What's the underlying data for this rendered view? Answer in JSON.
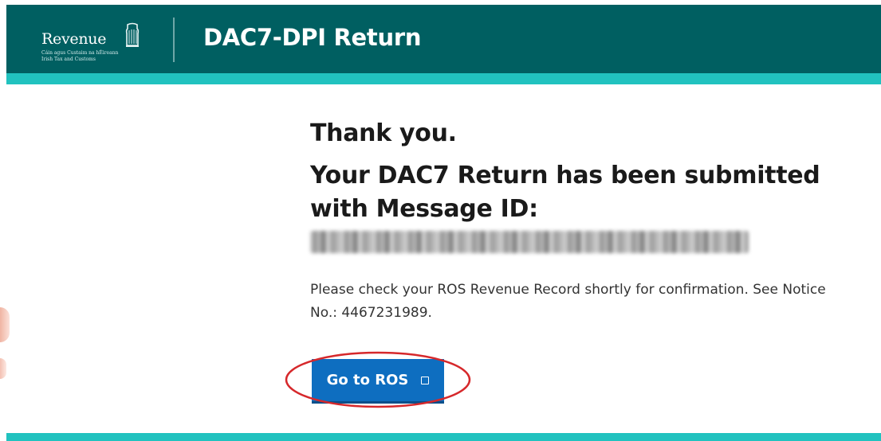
{
  "header": {
    "logo": {
      "name": "Revenue",
      "subtitle_line1": "Cáin agus Custaim na hÉireann",
      "subtitle_line2": "Irish Tax and Customs",
      "icon": "harp-icon"
    },
    "title": "DAC7-DPI Return"
  },
  "main": {
    "thank_you": "Thank you.",
    "submitted_message": "Your DAC7 Return has been submitted with Message ID:",
    "message_id_redacted": true,
    "notice_text": "Please check your ROS Revenue Record shortly for confirmation. See Notice No.: 4467231989.",
    "button": {
      "label": "Go to ROS",
      "icon": "external-link-icon"
    }
  },
  "colors": {
    "header_bg": "#005f61",
    "accent_band": "#21c2bf",
    "button_bg": "#0e6ec0",
    "annotation_ellipse": "#d6282b",
    "text_dark": "#1a1a1a"
  }
}
